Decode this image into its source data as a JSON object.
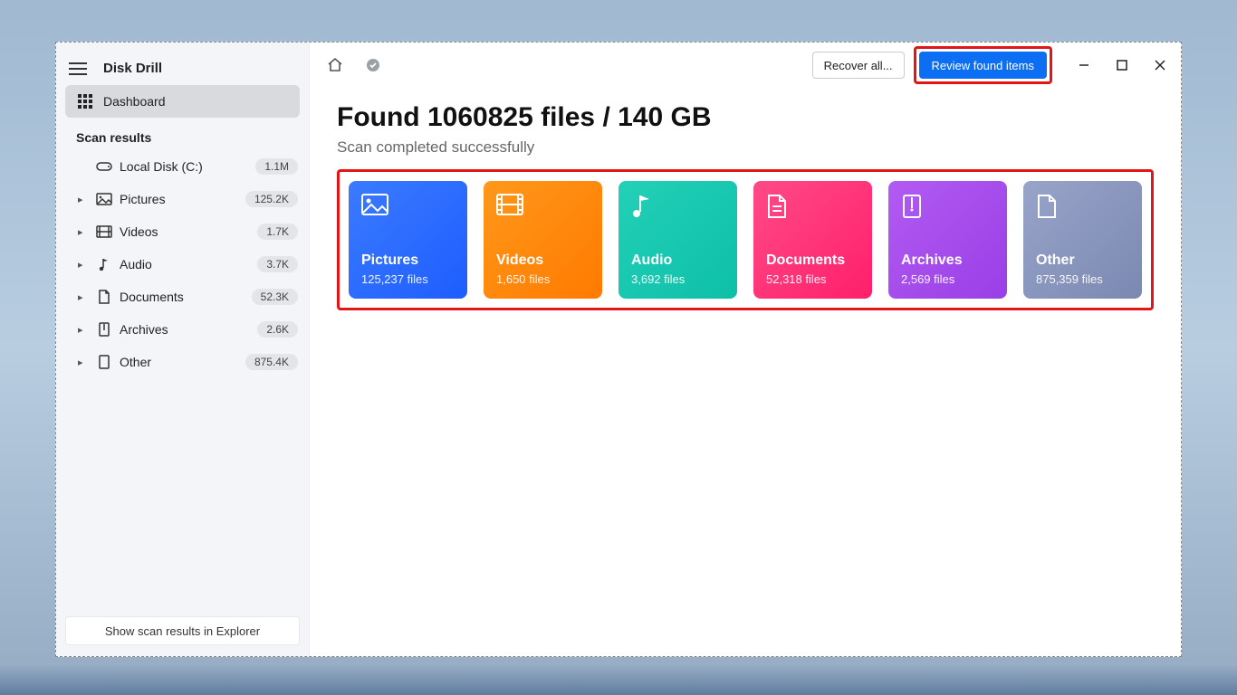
{
  "app": {
    "title": "Disk Drill"
  },
  "sidebar": {
    "dashboard_label": "Dashboard",
    "section_label": "Scan results",
    "disk": {
      "label": "Local Disk (C:)",
      "count": "1.1M"
    },
    "items": [
      {
        "label": "Pictures",
        "count": "125.2K"
      },
      {
        "label": "Videos",
        "count": "1.7K"
      },
      {
        "label": "Audio",
        "count": "3.7K"
      },
      {
        "label": "Documents",
        "count": "52.3K"
      },
      {
        "label": "Archives",
        "count": "2.6K"
      },
      {
        "label": "Other",
        "count": "875.4K"
      }
    ],
    "footer_label": "Show scan results in Explorer"
  },
  "toolbar": {
    "recover_label": "Recover all...",
    "review_label": "Review found items"
  },
  "summary": {
    "headline": "Found 1060825 files / 140 GB",
    "subhead": "Scan completed successfully"
  },
  "cards": [
    {
      "title": "Pictures",
      "sub": "125,237 files"
    },
    {
      "title": "Videos",
      "sub": "1,650 files"
    },
    {
      "title": "Audio",
      "sub": "3,692 files"
    },
    {
      "title": "Documents",
      "sub": "52,318 files"
    },
    {
      "title": "Archives",
      "sub": "2,569 files"
    },
    {
      "title": "Other",
      "sub": "875,359 files"
    }
  ]
}
